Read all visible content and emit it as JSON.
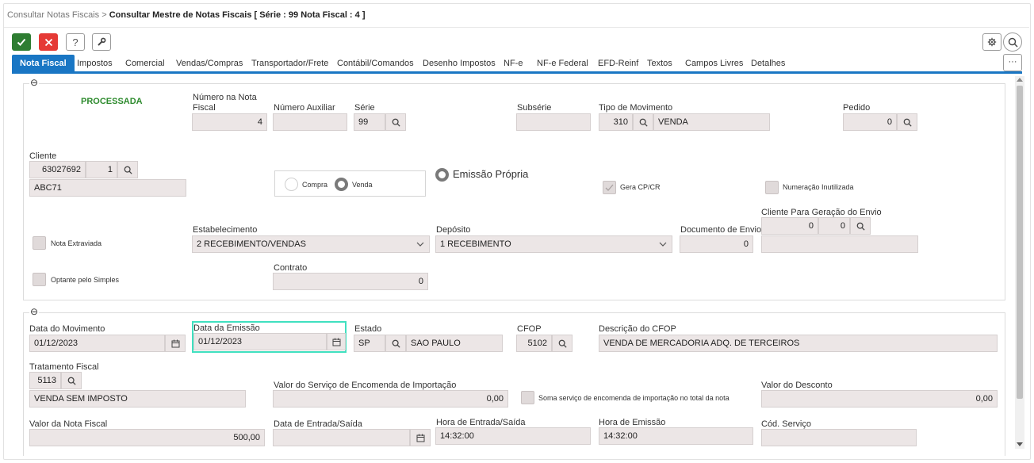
{
  "breadcrumb": {
    "parent": "Consultar Notas Fiscais",
    "separator": ">",
    "current": "Consultar Mestre de Notas Fiscais [ Série : 99 Nota Fiscal : 4 ]"
  },
  "toolbar": {
    "help_glyph": "?"
  },
  "tabs": [
    "Nota Fiscal",
    "Impostos",
    "Comercial",
    "Vendas/Compras",
    "Transportador/Frete",
    "Contábil/Comandos",
    "Desenho Impostos",
    "NF-e",
    "NF-e Federal",
    "EFD-Reinf",
    "Textos",
    "Campos Livres",
    "Detalhes"
  ],
  "more_label": "···",
  "collapse_glyph": "⊖",
  "section1": {
    "status": "PROCESSADA",
    "numero_label_1": "Número na Nota",
    "numero_label_2": "Fiscal",
    "numero_value": "4",
    "numero_aux_label": "Número Auxiliar",
    "numero_aux_value": "",
    "serie_label": "Série",
    "serie_value": "99",
    "subserie_label": "Subsérie",
    "subserie_value": "",
    "tipo_mov_label": "Tipo de Movimento",
    "tipo_mov_code": "310",
    "tipo_mov_desc": "VENDA",
    "pedido_label": "Pedido",
    "pedido_value": "0",
    "cliente_label": "Cliente",
    "cliente_code": "63027692",
    "cliente_seq": "1",
    "cliente_name": "ABC71",
    "compra_label": "Compra",
    "venda_label": "Venda",
    "emissao_propria_label": "Emissão Própria",
    "gera_cpcr_label": "Gera CP/CR",
    "numeracao_label": "Numeração Inutilizada",
    "estabelecimento_label": "Estabelecimento",
    "estabelecimento_value": "2 RECEBIMENTO/VENDAS",
    "deposito_label": "Depósito",
    "deposito_value": "1 RECEBIMENTO",
    "doc_envio_label": "Documento de Envio",
    "doc_envio_value": "0",
    "cliente_envio_label": "Cliente Para Geração do Envio",
    "cliente_envio_code": "0",
    "cliente_envio_seq": "0",
    "cliente_envio_name": "",
    "nota_extraviada_label": "Nota Extraviada",
    "contrato_label": "Contrato",
    "contrato_value": "0",
    "optante_label": "Optante pelo Simples"
  },
  "section2": {
    "data_mov_label": "Data do Movimento",
    "data_mov_value": "01/12/2023",
    "data_emissao_label": "Data da Emissão",
    "data_emissao_value": "01/12/2023",
    "estado_label": "Estado",
    "estado_code": "SP",
    "estado_name": "SAO PAULO",
    "cfop_label": "CFOP",
    "cfop_value": "5102",
    "desc_cfop_label": "Descrição do CFOP",
    "desc_cfop_value": "VENDA DE MERCADORIA ADQ. DE TERCEIROS",
    "trat_fiscal_label": "Tratamento Fiscal",
    "trat_fiscal_code": "5113",
    "trat_fiscal_desc": "VENDA SEM IMPOSTO",
    "valor_servico_label": "Valor do Serviço de Encomenda de Importação",
    "valor_servico_value": "0,00",
    "soma_servico_label": "Soma serviço de encomenda de importação no total da nota",
    "valor_desconto_label": "Valor do Desconto",
    "valor_desconto_value": "0,00",
    "valor_nf_label": "Valor da Nota Fiscal",
    "valor_nf_value": "500,00",
    "data_entrada_label": "Data de Entrada/Saída",
    "data_entrada_value": "",
    "hora_entrada_label": "Hora de Entrada/Saída",
    "hora_entrada_value": "14:32:00",
    "hora_emissao_label": "Hora de Emissão",
    "hora_emissao_value": "14:32:00",
    "cod_servico_label": "Cód. Serviço",
    "cod_servico_value": ""
  },
  "colors": {
    "accent": "#1976c4",
    "ok": "#2e7d32",
    "cancel": "#e53935",
    "status": "#2e8b2e",
    "focus": "#40e0c0"
  }
}
